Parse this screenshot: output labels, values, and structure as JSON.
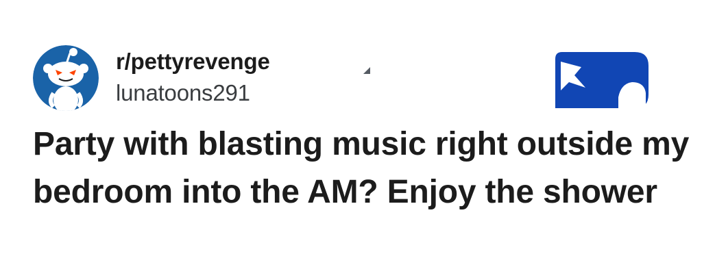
{
  "post": {
    "subreddit": "r/pettyrevenge",
    "username": "lunatoons291",
    "title": "Party with blasting music right outside my bedroom into the AM? Enjoy the shower"
  },
  "icons": {
    "avatar": "snoo-avatar-icon",
    "badge": "badge-icon"
  },
  "colors": {
    "avatar_bg": "#1a63a8",
    "badge_bg": "#1146b4",
    "text": "#1c1c1c"
  }
}
